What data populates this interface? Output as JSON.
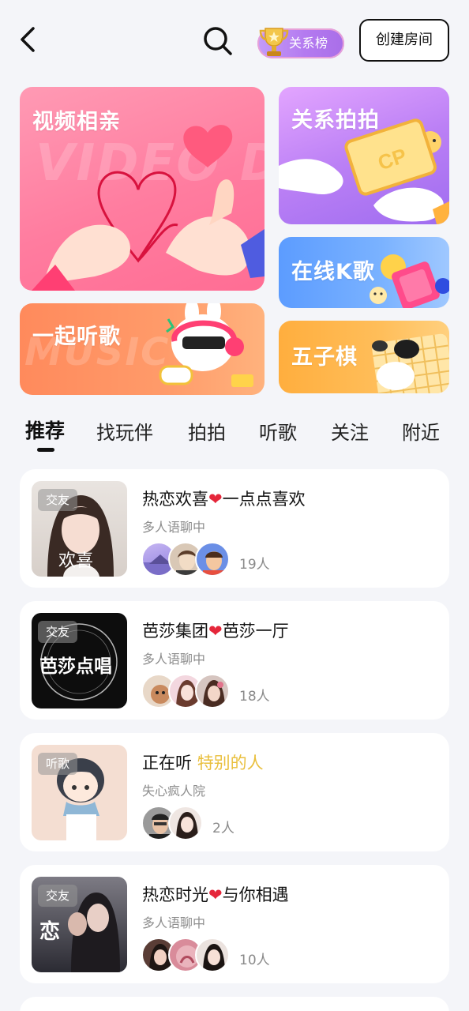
{
  "header": {
    "rank_label": "关系榜",
    "create_label": "创建房间"
  },
  "banners": {
    "video": {
      "title": "视频相亲",
      "watermark": "VIDEO DATE"
    },
    "music": {
      "title": "一起听歌",
      "watermark": "MUSIC"
    },
    "photo": {
      "title": "关系拍拍",
      "badge": "CP"
    },
    "ktv": {
      "title": "在线K歌"
    },
    "gomoku": {
      "title": "五子棋"
    }
  },
  "tabs": [
    {
      "label": "推荐",
      "active": true
    },
    {
      "label": "找玩伴"
    },
    {
      "label": "拍拍"
    },
    {
      "label": "听歌"
    },
    {
      "label": "关注"
    },
    {
      "label": "附近"
    }
  ],
  "rooms": [
    {
      "tag": "交友",
      "name_part1": "热恋欢喜",
      "heart": "❤",
      "name_part2": "一点点喜欢",
      "subtitle": "多人语聊中",
      "count": "19人",
      "cover_text": "欢喜"
    },
    {
      "tag": "交友",
      "name_part1": "芭莎集团",
      "heart": "❤",
      "name_part2": "芭莎一厅",
      "subtitle": "多人语聊中",
      "count": "18人",
      "cover_text": "芭莎点唱"
    },
    {
      "tag": "听歌",
      "name_part1": "正在听 ",
      "highlight": "特别的人",
      "subtitle": "失心疯人院",
      "count": "2人"
    },
    {
      "tag": "交友",
      "name_part1": "热恋时光",
      "heart": "❤",
      "name_part2": "与你相遇",
      "subtitle": "多人语聊中",
      "count": "10人",
      "cover_text": "恋"
    }
  ],
  "colors": {
    "background": "#f4f5f9",
    "heart": "#e5263a",
    "highlight": "#e9bf3c"
  }
}
